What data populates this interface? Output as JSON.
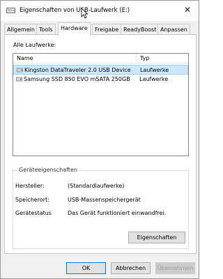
{
  "window": {
    "title": "Eigenschaften von USB-Laufwerk (E:)",
    "close_symbol": "✕"
  },
  "tabs": [
    {
      "label": "Allgemein"
    },
    {
      "label": "Tools"
    },
    {
      "label": "Hardware"
    },
    {
      "label": "Freigabe"
    },
    {
      "label": "ReadyBoost"
    },
    {
      "label": "Anpassen"
    }
  ],
  "active_tab": "Hardware",
  "drives": {
    "label": "Alle Laufwerke:",
    "columns": {
      "name": "Name",
      "type": "Typ"
    },
    "rows": [
      {
        "name": "Kingston DataTraveler 2.0 USB Device",
        "type": "Laufwerke",
        "selected": true
      },
      {
        "name": "Samsung SSD 850 EVO mSATA 250GB",
        "type": "Laufwerke",
        "selected": false
      }
    ]
  },
  "device_properties": {
    "title": "Geräteeigenschaften",
    "manufacturer_label": "Hersteller:",
    "manufacturer_value": "(Standardlaufwerke)",
    "location_label": "Speicherort:",
    "location_value": "USB-Massenspeichergerät",
    "status_label": "Gerätestatus",
    "status_value": "Das Gerät funktioniert einwandfrei.",
    "properties_button": "Eigenschaften"
  },
  "footer": {
    "ok": "OK",
    "cancel": "Abbrechen",
    "apply": "Übernehmen"
  },
  "colors": {
    "selection_bg": "#cce8ff",
    "selection_border": "#99d1ff",
    "accent": "#0078d7"
  }
}
